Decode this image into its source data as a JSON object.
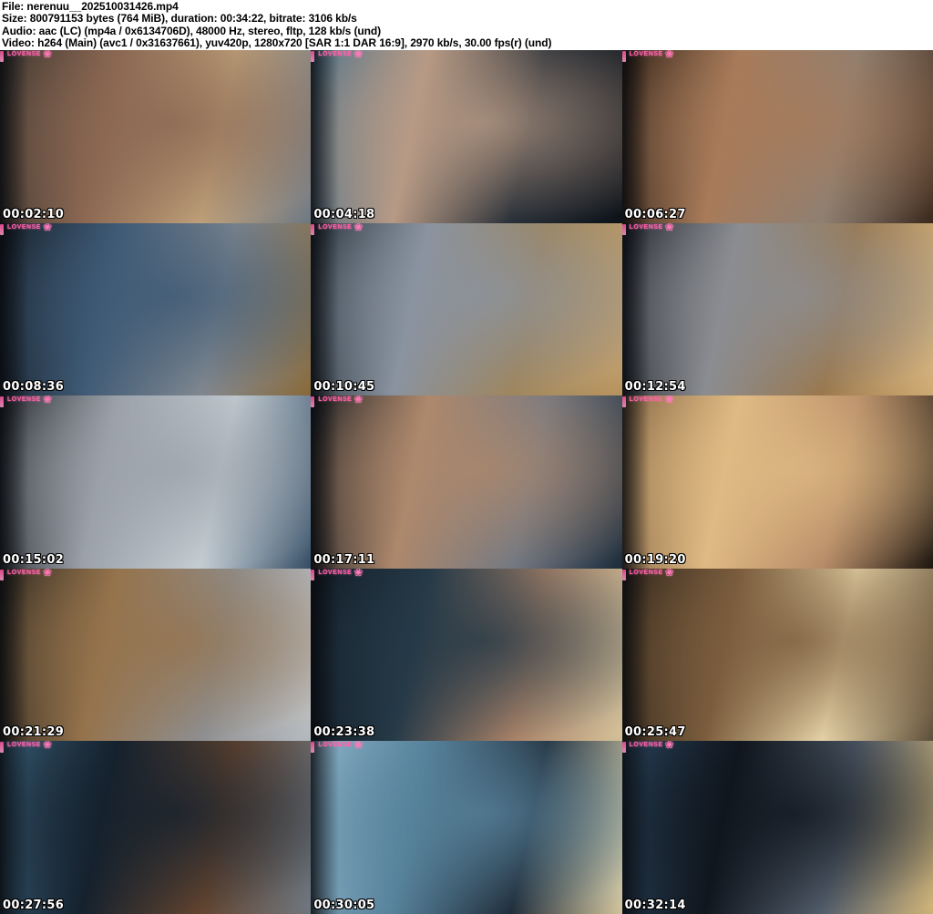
{
  "header": {
    "lines": [
      "File: nerenuu__202510031426.mp4",
      "Size: 800791153 bytes (764 MiB), duration: 00:34:22, bitrate: 3106 kb/s",
      "Audio: aac (LC) (mp4a / 0x6134706D), 48000 Hz, stereo, fltp, 128 kb/s (und)",
      "Video: h264 (Main) (avc1 / 0x31637661), yuv420p, 1280x720 [SAR 1:1 DAR 16:9], 2970 kb/s, 30.00 fps(r) (und)"
    ],
    "text_color": "#000000",
    "background_color": "#ffffff"
  },
  "watermark": {
    "label": "Lovense",
    "glyph": "❀",
    "color": "#ff5fa8"
  },
  "timestamp_style": {
    "color": "#ffffff",
    "outline_color": "#000000"
  },
  "thumbnails": [
    {
      "time": "00:02:10",
      "colors": [
        "#32302c",
        "#8b6752",
        "#c2a47c",
        "#77828d"
      ]
    },
    {
      "time": "00:04:18",
      "colors": [
        "#46708c",
        "#b79a85",
        "#1b2530",
        "#0f141b"
      ]
    },
    {
      "time": "00:06:27",
      "colors": [
        "#241810",
        "#a87b5a",
        "#8b8075",
        "#402c1f"
      ]
    },
    {
      "time": "00:08:36",
      "colors": [
        "#11161d",
        "#3e5a75",
        "#878c93",
        "#93713f"
      ]
    },
    {
      "time": "00:10:45",
      "colors": [
        "#1e2a33",
        "#8a93a0",
        "#a08457",
        "#c7a067"
      ]
    },
    {
      "time": "00:12:54",
      "colors": [
        "#171b23",
        "#8b8d92",
        "#9c7647",
        "#e0b97d"
      ]
    },
    {
      "time": "00:15:02",
      "colors": [
        "#191c21",
        "#9ba1a9",
        "#c9d2d8",
        "#3a556d"
      ]
    },
    {
      "time": "00:17:11",
      "colors": [
        "#0d131a",
        "#ad886c",
        "#6f7885",
        "#1e2f3f"
      ]
    },
    {
      "time": "00:19:20",
      "colors": [
        "#7d5e3e",
        "#dfba83",
        "#b28766",
        "#221a12"
      ]
    },
    {
      "time": "00:21:29",
      "colors": [
        "#23201b",
        "#95734c",
        "#8d9197",
        "#c3c9cf"
      ]
    },
    {
      "time": "00:23:38",
      "colors": [
        "#0f1720",
        "#253947",
        "#b2876a",
        "#e4cfa4"
      ]
    },
    {
      "time": "00:25:47",
      "colors": [
        "#281f17",
        "#7b5d3d",
        "#eedcb0",
        "#67563f"
      ]
    },
    {
      "time": "00:27:56",
      "colors": [
        "#39607a",
        "#15212d",
        "#6a472f",
        "#778089"
      ]
    },
    {
      "time": "00:30:05",
      "colors": [
        "#93b9cf",
        "#57829b",
        "#1b2531",
        "#e3d4aa"
      ]
    },
    {
      "time": "00:32:14",
      "colors": [
        "#2b465e",
        "#10161e",
        "#596472",
        "#dfc080"
      ]
    }
  ]
}
